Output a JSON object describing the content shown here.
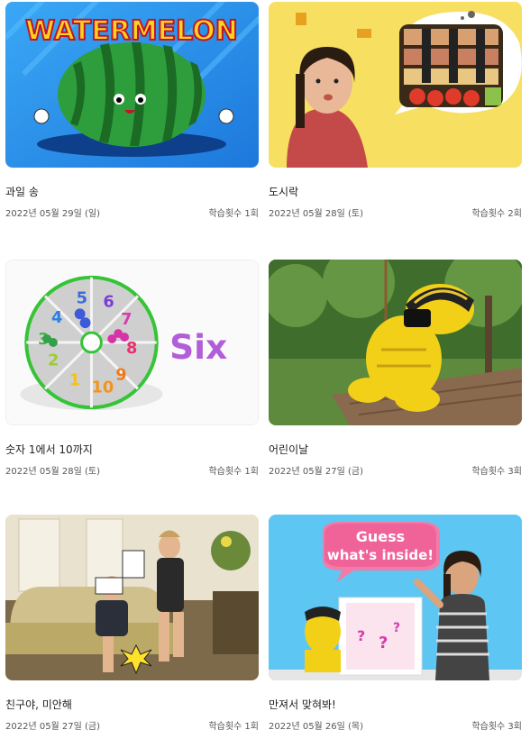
{
  "cards": [
    {
      "title": "과일 송",
      "date": "2022년 05월 29일 (일)",
      "count": "학습횟수 1회",
      "thumb_text": "WATERMELON"
    },
    {
      "title": "도시락",
      "date": "2022년 05월 28일 (토)",
      "count": "학습횟수 2회"
    },
    {
      "title": "숫자 1에서 10까지",
      "date": "2022년 05월 28일 (토)",
      "count": "학습횟수 1회",
      "thumb_text": "Six"
    },
    {
      "title": "어린이날",
      "date": "2022년 05월 27일 (금)",
      "count": "학습횟수 3회"
    },
    {
      "title": "친구야, 미안해",
      "date": "2022년 05월 27일 (금)",
      "count": "학습횟수 1회"
    },
    {
      "title": "만져서 맞혀봐!",
      "date": "2022년 05월 26일 (목)",
      "count": "학습횟수 3회",
      "thumb_text_1": "Guess",
      "thumb_text_2": "what's inside!"
    }
  ],
  "colors": {
    "title": "#222222",
    "meta": "#555555"
  }
}
